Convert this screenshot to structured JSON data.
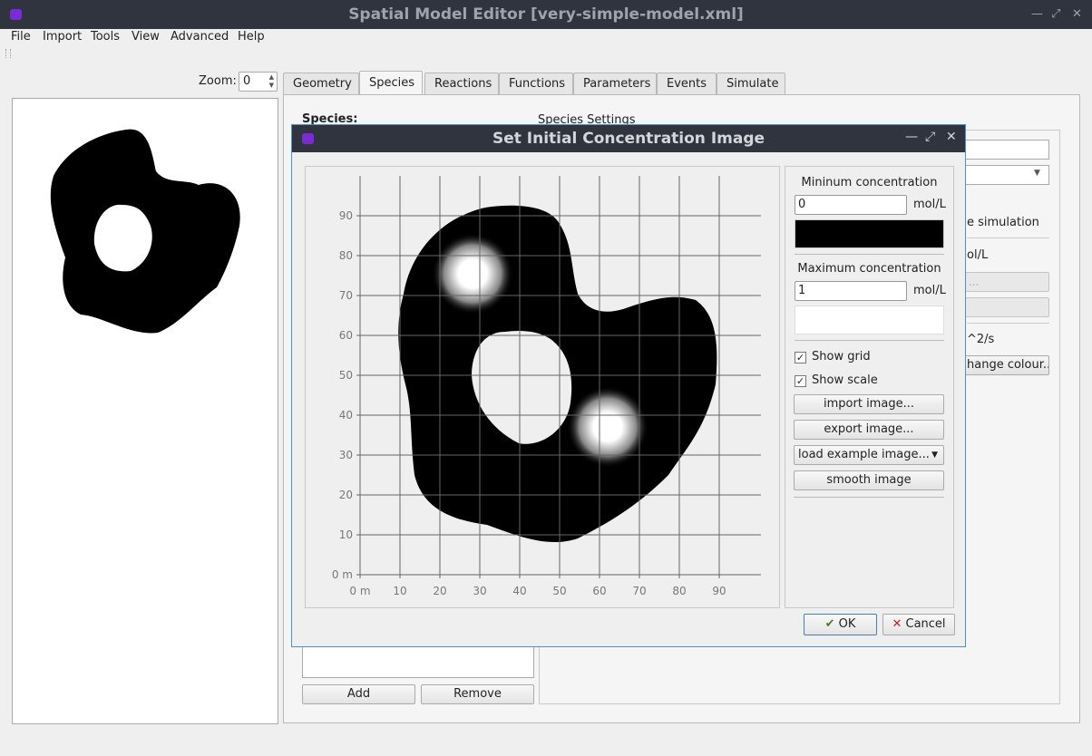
{
  "app": {
    "title": "Spatial Model Editor [very-simple-model.xml]"
  },
  "menu": {
    "file": "File",
    "import": "Import",
    "tools": "Tools",
    "view": "View",
    "advanced": "Advanced",
    "help": "Help"
  },
  "zoom": {
    "label": "Zoom:",
    "value": "0"
  },
  "tabs": [
    {
      "label": "Geometry"
    },
    {
      "label": "Species"
    },
    {
      "label": "Reactions"
    },
    {
      "label": "Functions"
    },
    {
      "label": "Parameters"
    },
    {
      "label": "Events"
    },
    {
      "label": "Simulate"
    }
  ],
  "species_tab": {
    "heading": "Species:",
    "settings_heading": "Species Settings",
    "partial_sim_text": "e simulation",
    "partial_units": "ol/L",
    "partial_rate": "^2/s",
    "partial_colour_button": "hange colour...",
    "partial_button_text": "...",
    "add_button": "Add",
    "remove_button": "Remove"
  },
  "dialog": {
    "title": "Set Initial Concentration Image",
    "min_label": "Mininum concentration",
    "min_value": "0",
    "min_unit": "mol/L",
    "min_color": "#000000",
    "max_label": "Maximum concentration",
    "max_value": "1",
    "max_unit": "mol/L",
    "max_color": "#ffffff",
    "show_grid": "Show grid",
    "show_scale": "Show scale",
    "import_button": "import image...",
    "export_button": "export image...",
    "example_combo": "load example image...",
    "smooth_button": "smooth image",
    "ok_button": "OK",
    "cancel_button": "Cancel",
    "x_ticks": [
      "0 m",
      "10",
      "20",
      "30",
      "40",
      "50",
      "60",
      "70",
      "80",
      "90"
    ],
    "y_ticks": [
      "0 m",
      "10",
      "20",
      "30",
      "40",
      "50",
      "60",
      "70",
      "80",
      "90"
    ]
  }
}
